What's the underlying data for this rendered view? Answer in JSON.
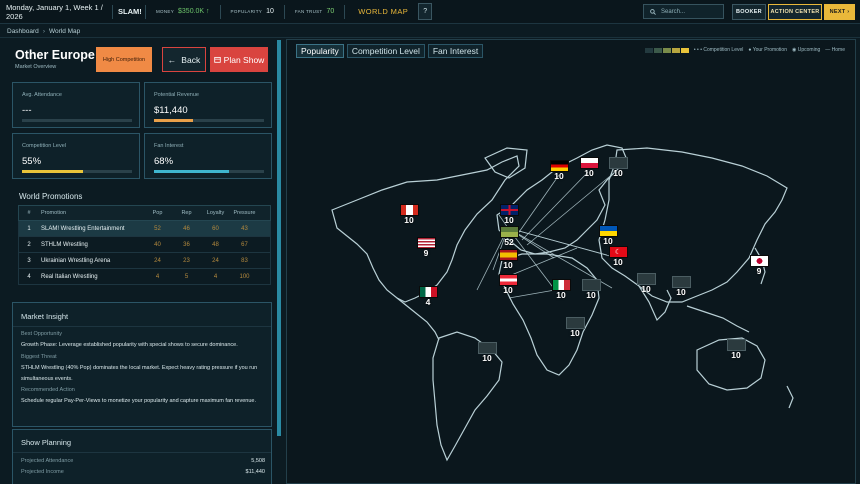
{
  "topbar": {
    "date": "Monday, January 1, Week 1 / 2026",
    "promotion": "SLAM!",
    "money_label": "MONEY",
    "money_value": "$350.0K ↑",
    "popularity_label": "POPULARITY",
    "popularity_value": "10",
    "fan_trust_label": "FAN TRUST",
    "fan_trust_value": "70",
    "world_map": "WORLD MAP",
    "help": "?",
    "search_placeholder": "Search...",
    "booker": "BOOKER",
    "action_center": "ACTION CENTER",
    "next": "NEXT ›"
  },
  "breadcrumb": {
    "home": "Dashboard",
    "sep": "›",
    "current": "World Map"
  },
  "region": {
    "title": "Other Europe",
    "subtitle": "Market Overview",
    "competition_badge": "High Competition",
    "back_label": "Back",
    "back_icon": "←",
    "plan_label": "Plan Show",
    "plan_icon": "🗓"
  },
  "stats": {
    "attendance": {
      "label": "Avg. Attendance",
      "value": "---",
      "fill": 0.0
    },
    "revenue": {
      "label": "Potential Revenue",
      "value": "$11,440",
      "fill": 0.35
    },
    "competition": {
      "label": "Competition Level",
      "value": "55%",
      "fill": 0.55
    },
    "fan_interest": {
      "label": "Fan Interest",
      "value": "68%",
      "fill": 0.68
    }
  },
  "colors": {
    "bar_orange": "#e9a04a",
    "bar_yellow": "#e9c43a",
    "bar_teal": "#3fb6cf",
    "accent_gold": "#e9b83a",
    "danger_red": "#d9443f"
  },
  "promotions": {
    "title": "World Promotions",
    "headers": [
      "#",
      "Promotion",
      "Pop",
      "Rep",
      "Loyalty",
      "Pressure"
    ],
    "rows": [
      {
        "n": "1",
        "name": "SLAM! Wrestling Entertainment",
        "pop": "52",
        "rep": "46",
        "loyalty": "60",
        "pressure": "43"
      },
      {
        "n": "2",
        "name": "STHLM Wrestling",
        "pop": "40",
        "rep": "36",
        "loyalty": "48",
        "pressure": "67"
      },
      {
        "n": "3",
        "name": "Ukrainian Wrestling Arena",
        "pop": "24",
        "rep": "23",
        "loyalty": "24",
        "pressure": "83"
      },
      {
        "n": "4",
        "name": "Real Italian Wrestling",
        "pop": "4",
        "rep": "5",
        "loyalty": "4",
        "pressure": "100"
      }
    ]
  },
  "insight": {
    "title": "Market Insight",
    "opportunity_label": "Best Opportunity",
    "opportunity_text": "Growth Phase: Leverage established popularity with special shows to secure dominance.",
    "threat_label": "Biggest Threat",
    "threat_text": "STHLM Wrestling (40% Pop) dominates the local market. Expect heavy rating pressure if you run simultaneous events.",
    "action_label": "Recommended Action",
    "action_text": "Schedule regular Pay-Per-Views to monetize your popularity and capture maximum fan revenue."
  },
  "show_planning": {
    "title": "Show Planning",
    "projected_attendance_label": "Projected Attendance",
    "projected_attendance_value": "5,508",
    "projected_income_label": "Projected Income",
    "projected_income_value": "$11,440"
  },
  "map": {
    "tabs": [
      "Popularity",
      "Competition Level",
      "Fan Interest"
    ],
    "legend_competition": "Competition Level",
    "legend_your": "Your Promotion",
    "legend_upcoming": "Upcoming",
    "legend_home": "Home",
    "legend_colors": [
      "#233a3f",
      "#3c5a4a",
      "#7a8c4a",
      "#b7a63f",
      "#e9c43a"
    ],
    "markers": [
      {
        "country": "Canada",
        "value": "10",
        "flag": "canada"
      },
      {
        "country": "USA",
        "value": "9",
        "flag": "usa"
      },
      {
        "country": "Mexico",
        "value": "4",
        "flag": "mexico"
      },
      {
        "country": "UK",
        "value": "10",
        "flag": "uk"
      },
      {
        "country": "Germany",
        "value": "10",
        "flag": "germany"
      },
      {
        "country": "Poland",
        "value": "10",
        "flag": "poland"
      },
      {
        "country": "Region",
        "value": "10",
        "flag": "none"
      },
      {
        "country": "Other Europe",
        "value": "52",
        "flag": "other"
      },
      {
        "country": "Spain",
        "value": "10",
        "flag": "spain"
      },
      {
        "country": "Austria",
        "value": "10",
        "flag": "austria"
      },
      {
        "country": "Ukraine",
        "value": "10",
        "flag": "ukraine"
      },
      {
        "country": "Turkey",
        "value": "10",
        "flag": "turkey"
      },
      {
        "country": "Italy",
        "value": "10",
        "flag": "italy"
      },
      {
        "country": "Region",
        "value": "10",
        "flag": "none"
      },
      {
        "country": "Region",
        "value": "10",
        "flag": "none"
      },
      {
        "country": "Region",
        "value": "10",
        "flag": "none"
      },
      {
        "country": "Japan",
        "value": "9",
        "flag": "japan"
      },
      {
        "country": "Region",
        "value": "10",
        "flag": "none"
      },
      {
        "country": "Region",
        "value": "10",
        "flag": "none"
      },
      {
        "country": "Region",
        "value": "10",
        "flag": "none"
      }
    ]
  }
}
